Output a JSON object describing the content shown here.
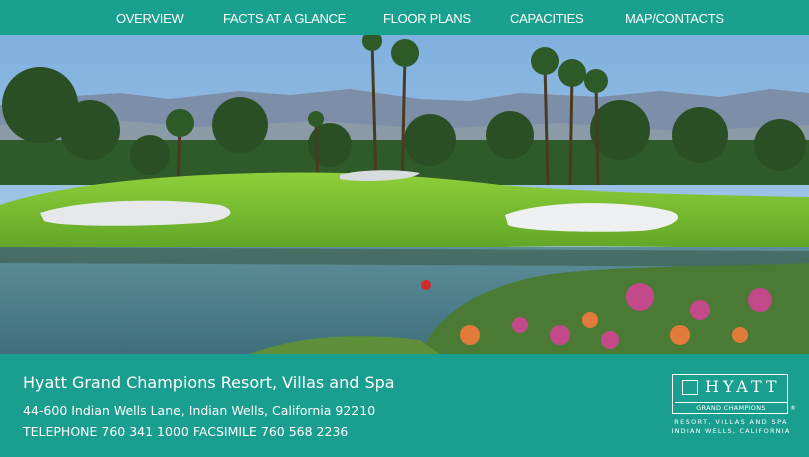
{
  "nav": {
    "items": [
      {
        "label": "OVERVIEW"
      },
      {
        "label": "FACTS AT A GLANCE"
      },
      {
        "label": "FLOOR PLANS"
      },
      {
        "label": "CAPACITIES"
      },
      {
        "label": "MAP/CONTACTS"
      }
    ]
  },
  "footer": {
    "resort_name": "Hyatt Grand Champions Resort, Villas and Spa",
    "address": "44-600 Indian Wells Lane, Indian Wells, California 92210",
    "phone_fax": "TELEPHONE 760 341 1000 FACSIMILE 760 568 2236"
  },
  "logo": {
    "brand": "HYATT",
    "sub": "GRAND CHAMPIONS",
    "registered": "®",
    "line1": "RESORT, VILLAS AND SPA",
    "line2": "INDIAN WELLS, CALIFORNIA"
  },
  "colors": {
    "teal": "#1a9e8f",
    "white": "#ffffff"
  }
}
